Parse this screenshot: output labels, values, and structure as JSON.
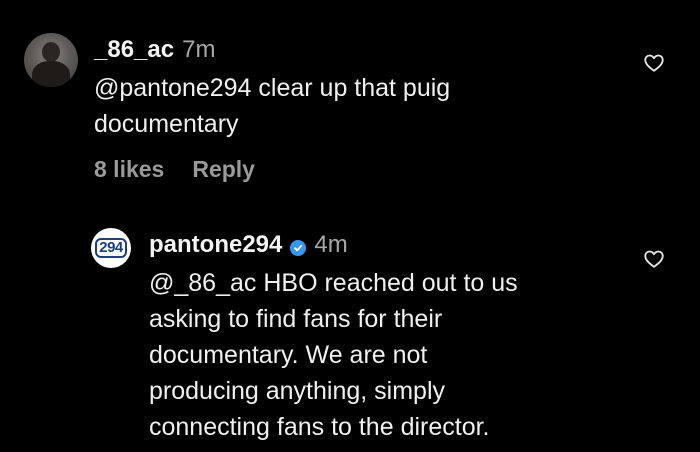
{
  "comments": [
    {
      "username": "_86_ac",
      "time": "7m",
      "text_lines": [
        "@pantone294 clear up that puig",
        "documentary"
      ],
      "likes": "8 likes",
      "reply_label": "Reply"
    },
    {
      "username": "pantone294",
      "verified": true,
      "avatar_text": "294",
      "time": "4m",
      "text_lines": [
        "@_86_ac HBO reached out to us",
        "asking to find fans for their",
        "documentary. We are not",
        "producing anything, simply",
        "connecting fans to the director."
      ]
    }
  ],
  "icons": {
    "like": "heart-outline-icon",
    "verified": "verified-badge-icon"
  },
  "colors": {
    "background": "#000000",
    "text": "#f0f0f0",
    "muted": "#9a9a9a",
    "verified_blue": "#3897f0"
  }
}
